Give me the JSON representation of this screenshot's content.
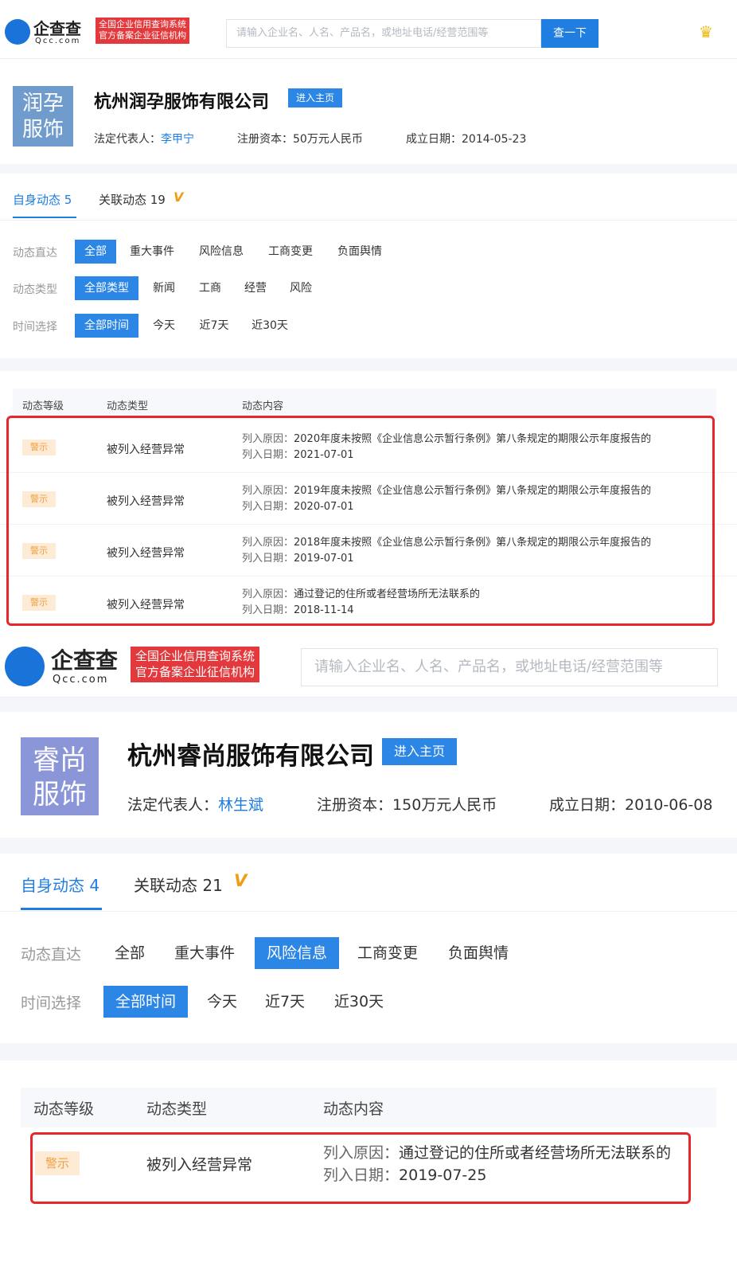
{
  "logo": {
    "brand": "企查查",
    "sub": "Qcc.com",
    "badge_line1": "全国企业信用查询系统",
    "badge_line2": "官方备案企业征信机构"
  },
  "search": {
    "placeholder": "请输入企业名、人名、产品名，或地址电话/经营范围等",
    "button": "查一下"
  },
  "labels": {
    "legal_rep": "法定代表人：",
    "capital": "注册资本：",
    "founded": "成立日期：",
    "enter_home": "进入主页",
    "filter_direct": "动态直达",
    "filter_type": "动态类型",
    "filter_time": "时间选择",
    "th_level": "动态等级",
    "th_type": "动态类型",
    "th_content": "动态内容",
    "reason": "列入原因：",
    "date": "列入日期："
  },
  "direct_options": [
    "全部",
    "重大事件",
    "风险信息",
    "工商变更",
    "负面舆情"
  ],
  "type_options": [
    "全部类型",
    "新闻",
    "工商",
    "经营",
    "风险"
  ],
  "time_options": [
    "全部时间",
    "今天",
    "近7天",
    "近30天"
  ],
  "company1": {
    "logo_line1": "润孕",
    "logo_line2": "服饰",
    "logo_color": "#6f9ccd",
    "name": "杭州润孕服饰有限公司",
    "legal_rep": "李甲宁",
    "capital": "50万元人民币",
    "founded": "2014-05-23",
    "tab_self": "自身动态 5",
    "tab_related": "关联动态 19",
    "rows": [
      {
        "level": "警示",
        "type": "被列入经营异常",
        "reason": "2020年度未按照《企业信息公示暂行条例》第八条规定的期限公示年度报告的",
        "date": "2021-07-01"
      },
      {
        "level": "警示",
        "type": "被列入经营异常",
        "reason": "2019年度未按照《企业信息公示暂行条例》第八条规定的期限公示年度报告的",
        "date": "2020-07-01"
      },
      {
        "level": "警示",
        "type": "被列入经营异常",
        "reason": "2018年度未按照《企业信息公示暂行条例》第八条规定的期限公示年度报告的",
        "date": "2019-07-01"
      },
      {
        "level": "警示",
        "type": "被列入经营异常",
        "reason": "通过登记的住所或者经营场所无法联系的",
        "date": "2018-11-14"
      }
    ]
  },
  "company2": {
    "logo_line1": "睿尚",
    "logo_line2": "服饰",
    "logo_color": "#8b96d8",
    "name": "杭州睿尚服饰有限公司",
    "legal_rep": "林生斌",
    "capital": "150万元人民币",
    "founded": "2010-06-08",
    "tab_self": "自身动态 4",
    "tab_related": "关联动态 21",
    "rows": [
      {
        "level": "警示",
        "type": "被列入经营异常",
        "reason": "通过登记的住所或者经营场所无法联系的",
        "date": "2019-07-25"
      }
    ]
  },
  "colors": {
    "accent": "#1f7ee0",
    "warn_bg": "#fdebd6",
    "warn_text": "#f0a040",
    "highlight": "#e8262c"
  },
  "icons": {
    "vip": "vip-icon",
    "crown": "crown-icon",
    "logo": "qcc-logo-icon"
  }
}
